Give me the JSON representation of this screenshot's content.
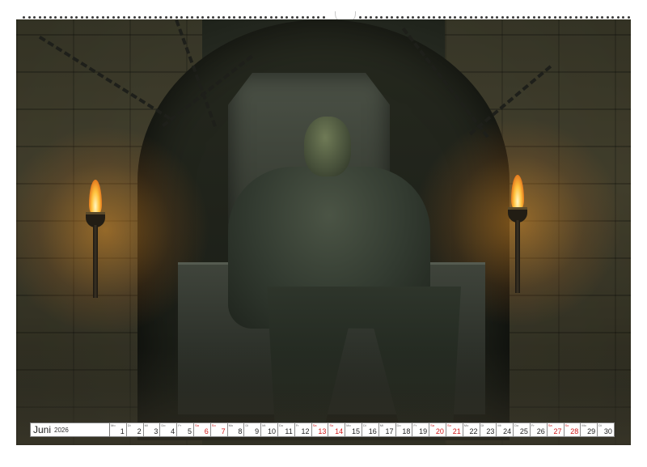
{
  "calendar": {
    "month": "Juni",
    "year": "2026",
    "days": [
      {
        "n": "1",
        "wd": "Mo",
        "weekend": false
      },
      {
        "n": "2",
        "wd": "Di",
        "weekend": false
      },
      {
        "n": "3",
        "wd": "Mi",
        "weekend": false
      },
      {
        "n": "4",
        "wd": "Do",
        "weekend": false
      },
      {
        "n": "5",
        "wd": "Fr",
        "weekend": false
      },
      {
        "n": "6",
        "wd": "Sa",
        "weekend": true
      },
      {
        "n": "7",
        "wd": "So",
        "weekend": true
      },
      {
        "n": "8",
        "wd": "Mo",
        "weekend": false
      },
      {
        "n": "9",
        "wd": "Di",
        "weekend": false
      },
      {
        "n": "10",
        "wd": "Mi",
        "weekend": false
      },
      {
        "n": "11",
        "wd": "Do",
        "weekend": false
      },
      {
        "n": "12",
        "wd": "Fr",
        "weekend": false
      },
      {
        "n": "13",
        "wd": "Sa",
        "weekend": true
      },
      {
        "n": "14",
        "wd": "So",
        "weekend": true
      },
      {
        "n": "15",
        "wd": "Mo",
        "weekend": false
      },
      {
        "n": "16",
        "wd": "Di",
        "weekend": false
      },
      {
        "n": "17",
        "wd": "Mi",
        "weekend": false
      },
      {
        "n": "18",
        "wd": "Do",
        "weekend": false
      },
      {
        "n": "19",
        "wd": "Fr",
        "weekend": false
      },
      {
        "n": "20",
        "wd": "Sa",
        "weekend": true
      },
      {
        "n": "21",
        "wd": "So",
        "weekend": true
      },
      {
        "n": "22",
        "wd": "Mo",
        "weekend": false
      },
      {
        "n": "23",
        "wd": "Di",
        "weekend": false
      },
      {
        "n": "24",
        "wd": "Mi",
        "weekend": false
      },
      {
        "n": "25",
        "wd": "Do",
        "weekend": false
      },
      {
        "n": "26",
        "wd": "Fr",
        "weekend": false
      },
      {
        "n": "27",
        "wd": "Sa",
        "weekend": true
      },
      {
        "n": "28",
        "wd": "So",
        "weekend": true
      },
      {
        "n": "29",
        "wd": "Mo",
        "weekend": false
      },
      {
        "n": "30",
        "wd": "Di",
        "weekend": false
      }
    ],
    "weekend_color": "#d01818"
  },
  "artwork": {
    "icon": "orc-on-throne-image"
  }
}
